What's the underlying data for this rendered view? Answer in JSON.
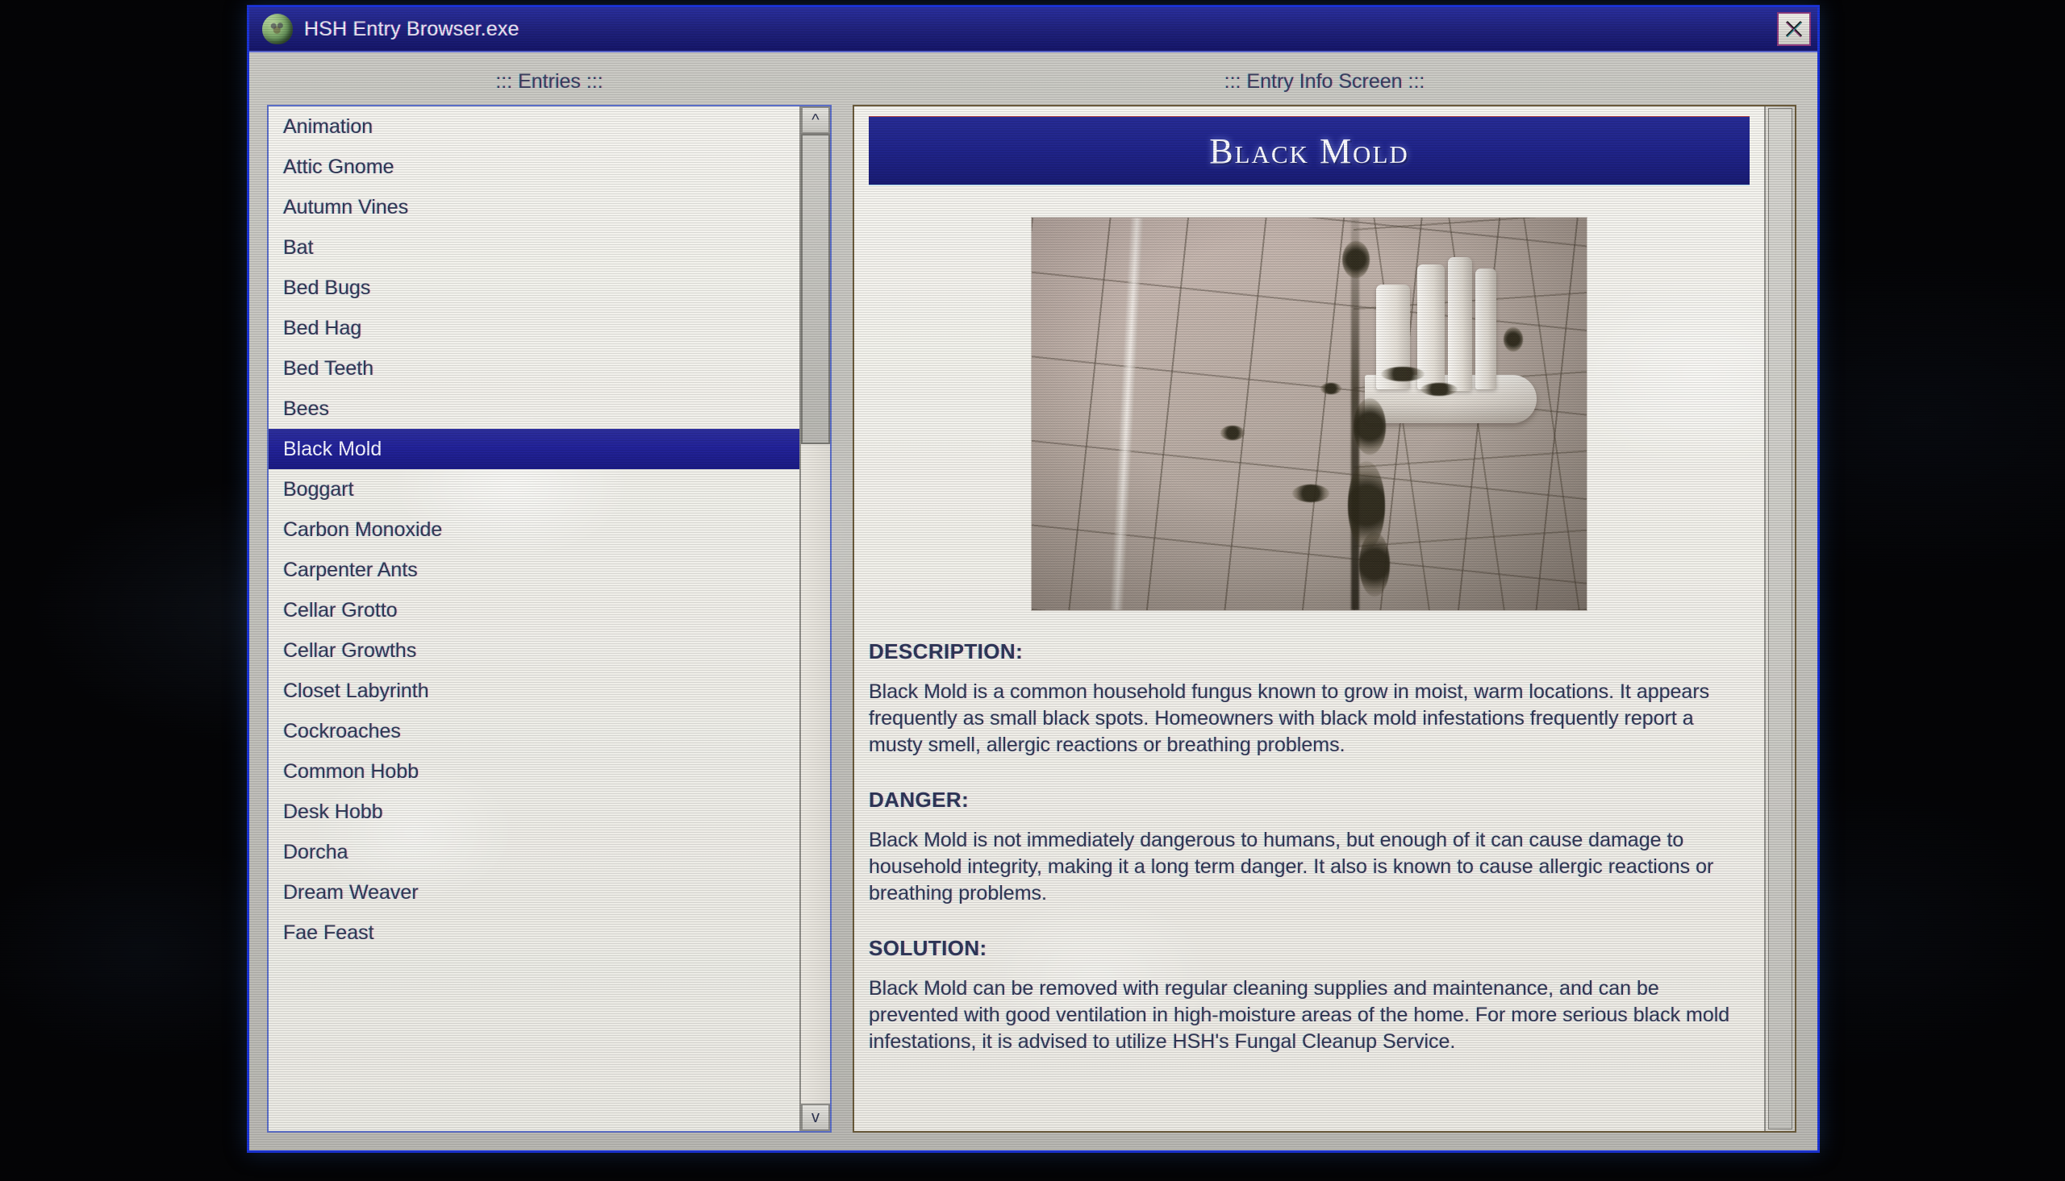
{
  "window": {
    "title": "HSH Entry Browser.exe",
    "icon": "skull-head-icon",
    "close_label": "close-icon",
    "border_color": "#1b34d8",
    "titlebar_color": "#21237f"
  },
  "entries_panel": {
    "heading": "::: Entries :::",
    "selected": "Black Mold",
    "scroll_up_label": "^",
    "scroll_down_label": "v",
    "items": [
      {
        "label": "Animation"
      },
      {
        "label": "Attic Gnome"
      },
      {
        "label": "Autumn Vines"
      },
      {
        "label": "Bat"
      },
      {
        "label": "Bed Bugs"
      },
      {
        "label": "Bed Hag"
      },
      {
        "label": "Bed Teeth"
      },
      {
        "label": "Bees"
      },
      {
        "label": "Black Mold"
      },
      {
        "label": "Boggart"
      },
      {
        "label": "Carbon Monoxide"
      },
      {
        "label": "Carpenter Ants"
      },
      {
        "label": "Cellar Grotto"
      },
      {
        "label": "Cellar Growths"
      },
      {
        "label": "Closet Labyrinth"
      },
      {
        "label": "Cockroaches"
      },
      {
        "label": "Common Hobb"
      },
      {
        "label": "Desk Hobb"
      },
      {
        "label": "Dorcha"
      },
      {
        "label": "Dream Weaver"
      },
      {
        "label": "Fae Feast"
      }
    ]
  },
  "info_panel": {
    "heading": "::: Entry Info Screen :::",
    "entry_title": "Black Mold",
    "photo_alt": "moldy-shower-tile-photo",
    "sections": [
      {
        "heading": "DESCRIPTION:",
        "body": "Black Mold is a common household fungus known to grow in moist, warm locations. It appears frequently as small black spots. Homeowners with black mold infestations frequently report a musty smell, allergic reactions or breathing problems."
      },
      {
        "heading": "DANGER:",
        "body": "Black Mold is not immediately dangerous to humans, but enough of it can cause damage to household integrity, making it a long term danger. It also is known to cause allergic reactions or breathing problems."
      },
      {
        "heading": "SOLUTION:",
        "body": "Black Mold can be removed with regular cleaning supplies and maintenance, and can be prevented with good ventilation in high-moisture areas of the home. For more serious black mold infestations, it is advised to utilize HSH's Fungal Cleanup Service."
      }
    ]
  }
}
